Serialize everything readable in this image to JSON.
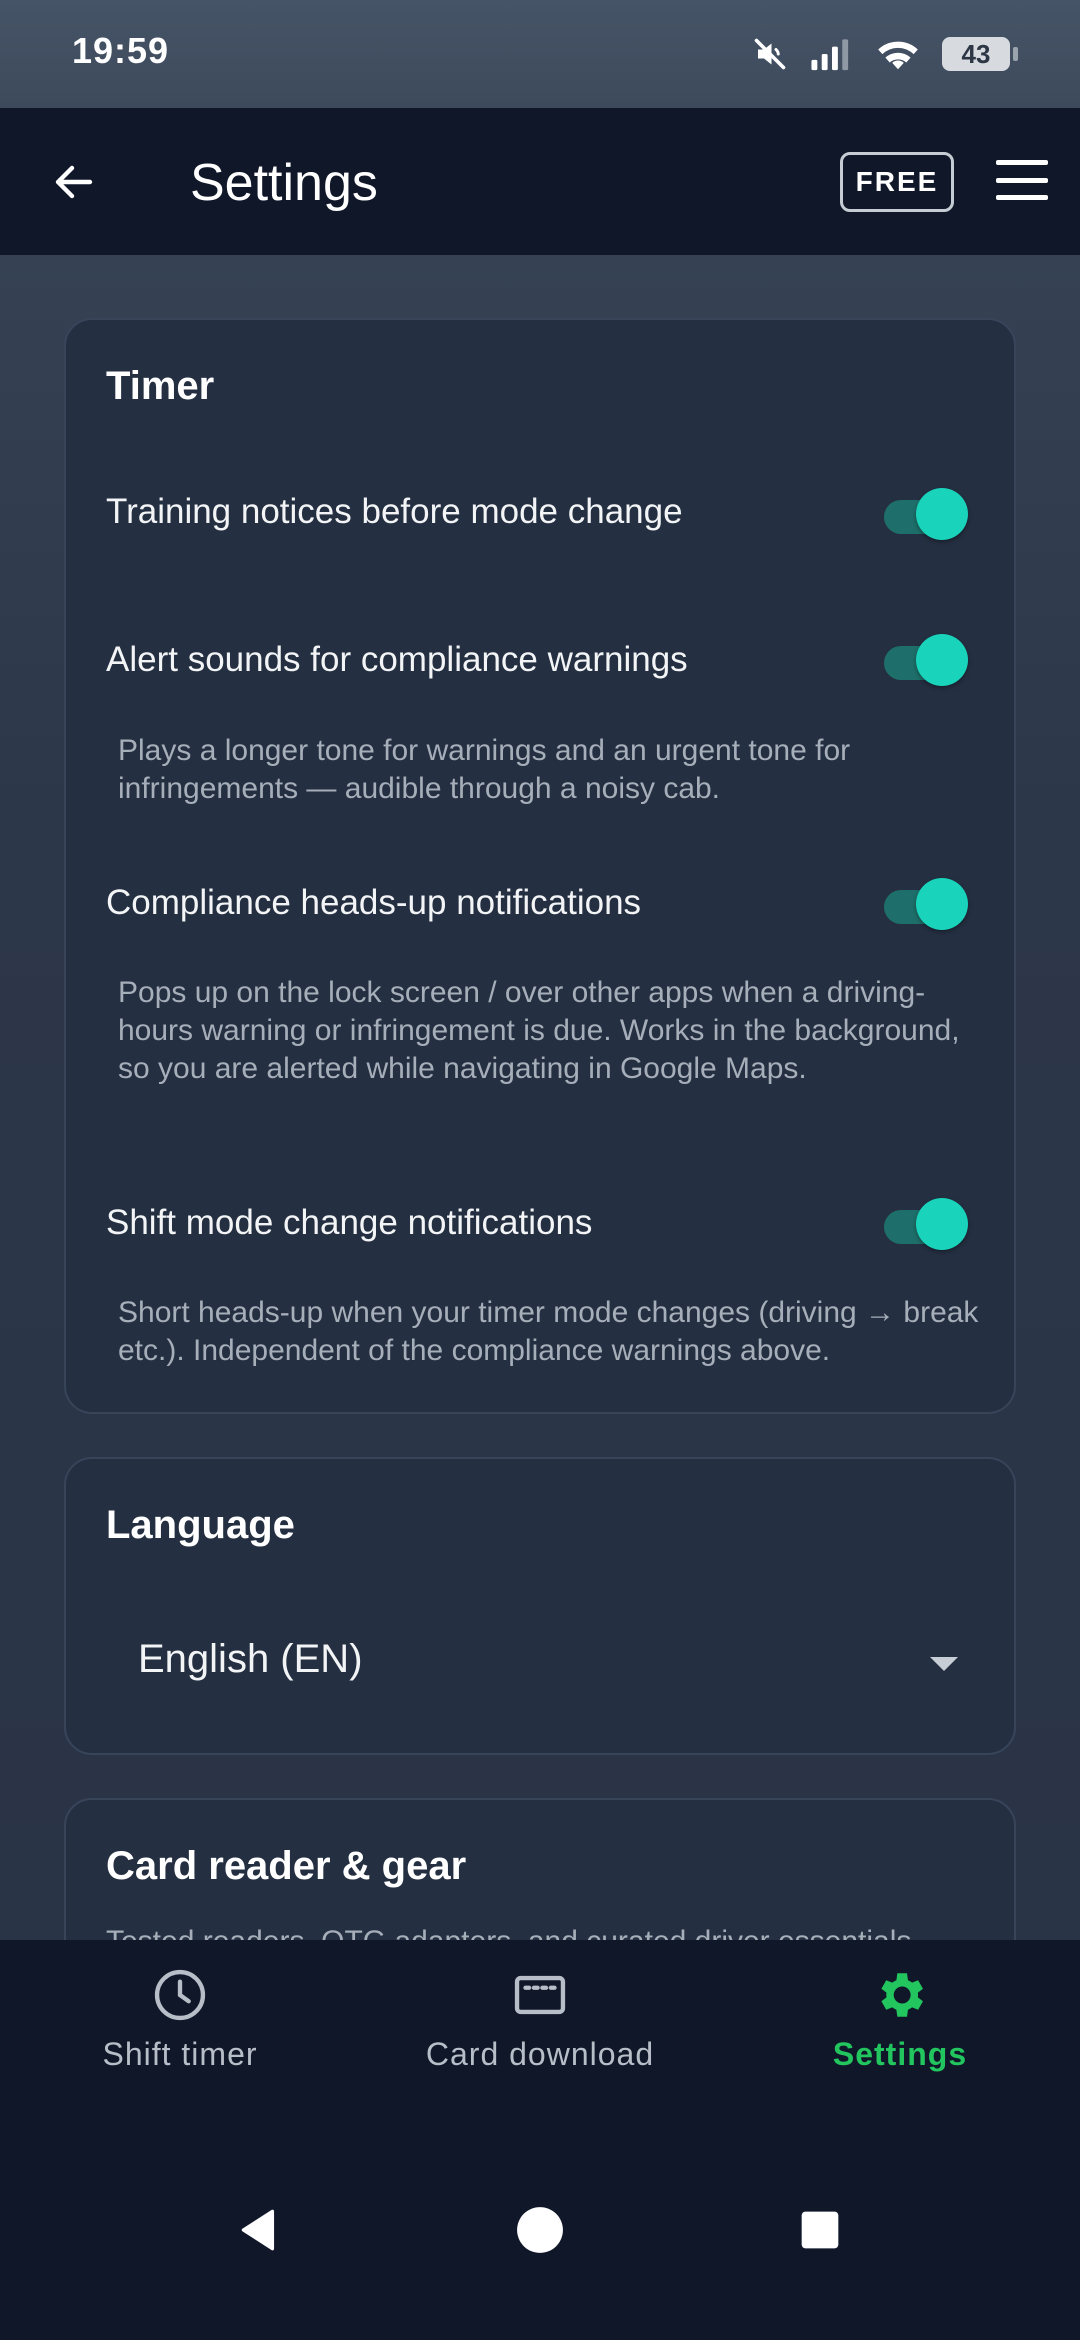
{
  "status_bar": {
    "time": "19:59",
    "battery_level": "43",
    "icons": [
      "mute-icon",
      "signal-icon",
      "wifi-icon",
      "battery-icon"
    ]
  },
  "app_bar": {
    "title": "Settings",
    "badge": "FREE",
    "back_icon": "arrow-left-icon",
    "menu_icon": "hamburger-menu-icon"
  },
  "timer_card": {
    "title": "Timer",
    "settings": [
      {
        "label": "Training notices before mode change",
        "enabled": true,
        "description": ""
      },
      {
        "label": "Alert sounds for compliance warnings",
        "enabled": true,
        "description": "Plays a longer tone for warnings and an urgent tone for infringements — audible through a noisy cab."
      },
      {
        "label": "Compliance heads-up notifications",
        "enabled": true,
        "description": "Pops up on the lock screen / over other apps when a driving-hours warning or infringement is due. Works in the background, so you are alerted while navigating in Google Maps."
      },
      {
        "label": "Shift mode change notifications",
        "enabled": true,
        "description": "Short heads-up when your timer mode changes (driving → break etc.). Independent of the compliance warnings above."
      }
    ]
  },
  "language_card": {
    "title": "Language",
    "selected": "English (EN)"
  },
  "gear_card": {
    "title": "Card reader & gear",
    "subtitle": "Tested readers, OTG adapters, and curated driver essentials"
  },
  "bottom_nav": {
    "items": [
      {
        "label": "Shift timer",
        "icon": "clock-icon",
        "active": false
      },
      {
        "label": "Card download",
        "icon": "card-reader-icon",
        "active": false
      },
      {
        "label": "Settings",
        "icon": "gear-icon",
        "active": true
      }
    ]
  },
  "colors": {
    "accent_toggle": "#19d3bb",
    "active_nav": "#22c55e",
    "app_bar": "#0f1729",
    "card": "#242f41"
  }
}
